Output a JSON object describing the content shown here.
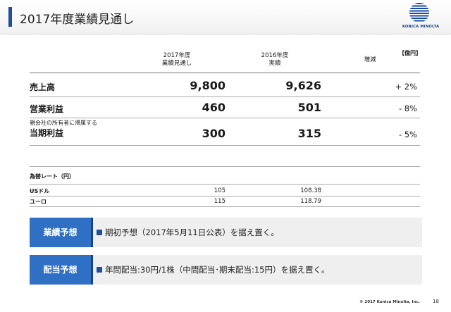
{
  "header": {
    "title": "2017年度業績見通し"
  },
  "logo": {
    "text": "KONICA MINOLTA"
  },
  "table": {
    "unit": "【億円】",
    "col_headers": [
      {
        "line1": "2017年度",
        "line2": "業績見通し"
      },
      {
        "line1": "2016年度",
        "line2": "実績"
      },
      {
        "line1": "増減",
        "line2": ""
      }
    ],
    "rows": [
      {
        "prefix": "",
        "label": "売上高",
        "forecast": "9,800",
        "actual": "9,626",
        "change": "+ 2%"
      },
      {
        "prefix": "",
        "label": "営業利益",
        "forecast": "460",
        "actual": "501",
        "change": "- 8%"
      },
      {
        "prefix": "親会社の所有者に帰属する",
        "label": "当期利益",
        "forecast": "300",
        "actual": "315",
        "change": "- 5%"
      }
    ]
  },
  "fx": {
    "title": "為替レート（円）",
    "rows": [
      {
        "label": "USドル",
        "forecast": "105",
        "actual": "108.38"
      },
      {
        "label": "ユーロ",
        "forecast": "115",
        "actual": "118.79"
      }
    ]
  },
  "notes": [
    {
      "tab": "業績予想",
      "text": "期初予想（2017年5月11日公表）を据え置く。"
    },
    {
      "tab": "配当予想",
      "text": "年間配当:30円/1株（中間配当･期末配当:15円）を据え置く。"
    }
  ],
  "footer": {
    "copyright": "© 2017 Konica Minolta, Inc.",
    "page": "18"
  }
}
